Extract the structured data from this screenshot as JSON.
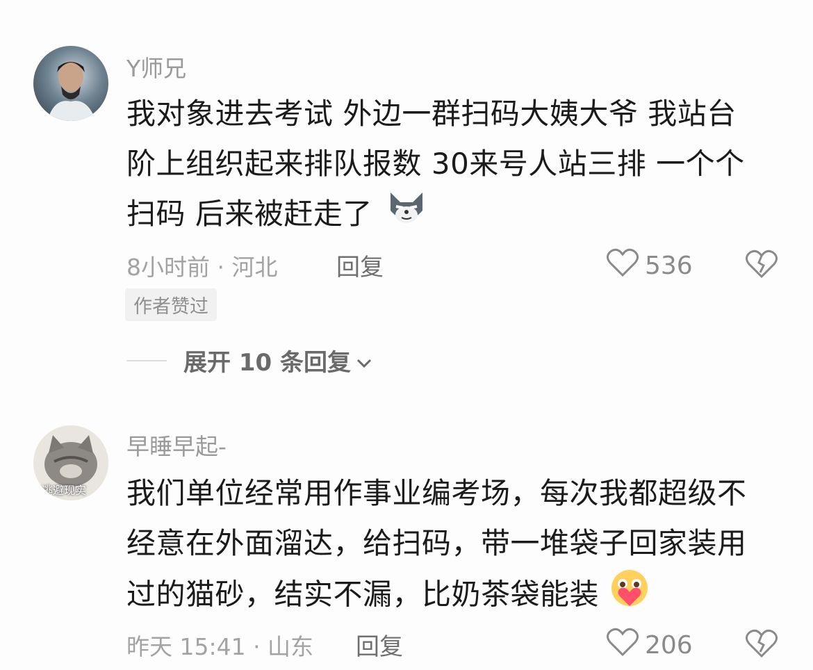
{
  "comments": [
    {
      "username": "Y师兄",
      "lines": [
        "我对象进去考试 外边一群扫码大姨大爷 我站台",
        "阶上组织起来排队报数 30来号人站三排 一个个",
        "扫码 后来被赶走了"
      ],
      "emoji": "wolf-emoji",
      "meta": "8小时前 · 河北",
      "reply_label": "回复",
      "likes": "536",
      "badge": "作者赞过",
      "expand_label": "展开 10 条回复"
    },
    {
      "username": "早睡早起-",
      "avatar_text": "逃避现实",
      "lines": [
        "我们单位经常用作事业编考场，每次我都超级不",
        "经意在外面溜达，给扫码，带一堆袋子回家装用",
        "过的猫砂，结实不漏，比奶茶袋能装"
      ],
      "emoji": "hug-heart-emoji",
      "meta": "昨天 15:41 · 山东",
      "reply_label": "回复",
      "likes": "206"
    }
  ],
  "colors": {
    "username": "#9a9a9a",
    "text": "#1b1b1b",
    "meta": "#a3a3a3",
    "icon": "#8a8a8a"
  }
}
